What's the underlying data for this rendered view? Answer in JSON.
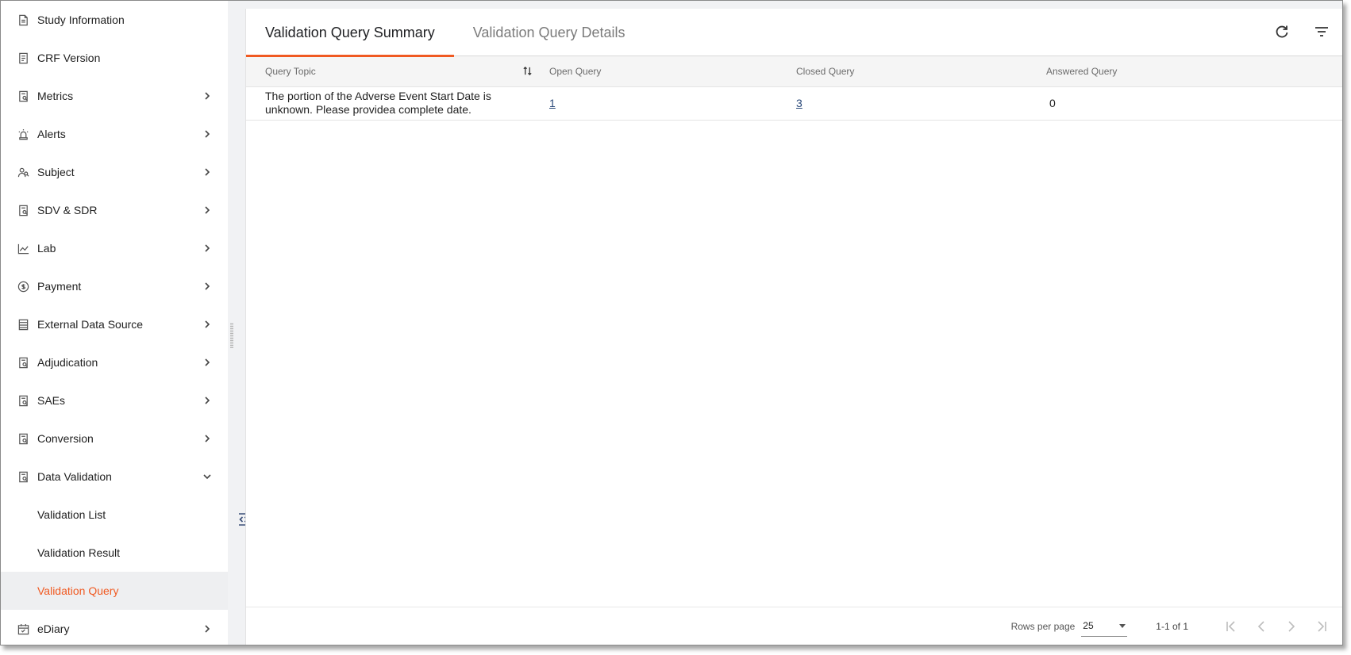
{
  "sidebar": {
    "items": [
      {
        "label": "Study Information",
        "icon": "document-icon",
        "has_children": false
      },
      {
        "label": "CRF Version",
        "icon": "form-icon",
        "has_children": false
      },
      {
        "label": "Metrics",
        "icon": "report-icon",
        "has_children": true
      },
      {
        "label": "Alerts",
        "icon": "siren-icon",
        "has_children": true
      },
      {
        "label": "Subject",
        "icon": "users-icon",
        "has_children": true
      },
      {
        "label": "SDV & SDR",
        "icon": "report-icon",
        "has_children": true
      },
      {
        "label": "Lab",
        "icon": "line-chart-icon",
        "has_children": true
      },
      {
        "label": "Payment",
        "icon": "payment-icon",
        "has_children": true
      },
      {
        "label": "External Data Source",
        "icon": "list-icon",
        "has_children": true
      },
      {
        "label": "Adjudication",
        "icon": "report-icon",
        "has_children": true
      },
      {
        "label": "SAEs",
        "icon": "report-icon",
        "has_children": true
      },
      {
        "label": "Conversion",
        "icon": "report-icon",
        "has_children": true
      },
      {
        "label": "Data Validation",
        "icon": "report-icon",
        "has_children": true,
        "expanded": true
      }
    ],
    "sub_items": [
      {
        "label": "Validation List"
      },
      {
        "label": "Validation Result"
      },
      {
        "label": "Validation Query",
        "active": true
      }
    ],
    "trailing_items": [
      {
        "label": "eDiary",
        "icon": "calendar-icon",
        "has_children": true
      }
    ]
  },
  "tabs": [
    {
      "label": "Validation Query Summary",
      "active": true
    },
    {
      "label": "Validation Query Details",
      "active": false
    }
  ],
  "toolbar": {
    "refresh_icon": "refresh-icon",
    "filter_icon": "filter-icon"
  },
  "table": {
    "columns": [
      "Query Topic",
      "Open Query",
      "Closed Query",
      "Answered Query"
    ],
    "rows": [
      {
        "topic": "The portion of the Adverse Event Start Date is unknown. Please providea complete date.",
        "open": "1",
        "closed": "3",
        "answered": "0"
      }
    ]
  },
  "footer": {
    "rows_per_page_label": "Rows per page",
    "rows_per_page_value": "25",
    "range_label": "1-1 of 1"
  },
  "colors": {
    "accent": "#f05a22",
    "link": "#2b4a7a"
  }
}
